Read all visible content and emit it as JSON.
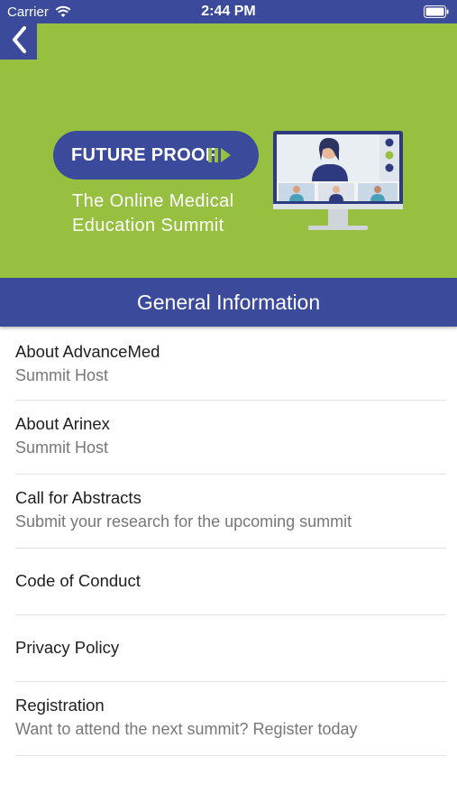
{
  "status_bar": {
    "carrier": "Carrier",
    "time": "2:44 PM",
    "wifi_icon": "wifi-icon",
    "battery_icon": "battery-icon"
  },
  "hero": {
    "back_icon": "chevron-left-icon",
    "banner_title": "FUTURE PROOF",
    "banner_subtitle": "The Online Medical Education Summit",
    "illustration": "video-conference-monitor"
  },
  "section": {
    "title": "General Information"
  },
  "items": [
    {
      "title": "About AdvanceMed",
      "subtitle": "Summit Host"
    },
    {
      "title": "About Arinex",
      "subtitle": "Summit Host"
    },
    {
      "title": "Call for Abstracts",
      "subtitle": "Submit your research for the upcoming summit"
    },
    {
      "title": "Code of Conduct"
    },
    {
      "title": "Privacy Policy"
    },
    {
      "title": "Registration",
      "subtitle": "Want to attend the next summit? Register today"
    }
  ],
  "colors": {
    "brand_blue": "#3b4a9b",
    "brand_green": "#97c040",
    "divider": "#e2e2e2",
    "subtitle_gray": "#777777"
  }
}
